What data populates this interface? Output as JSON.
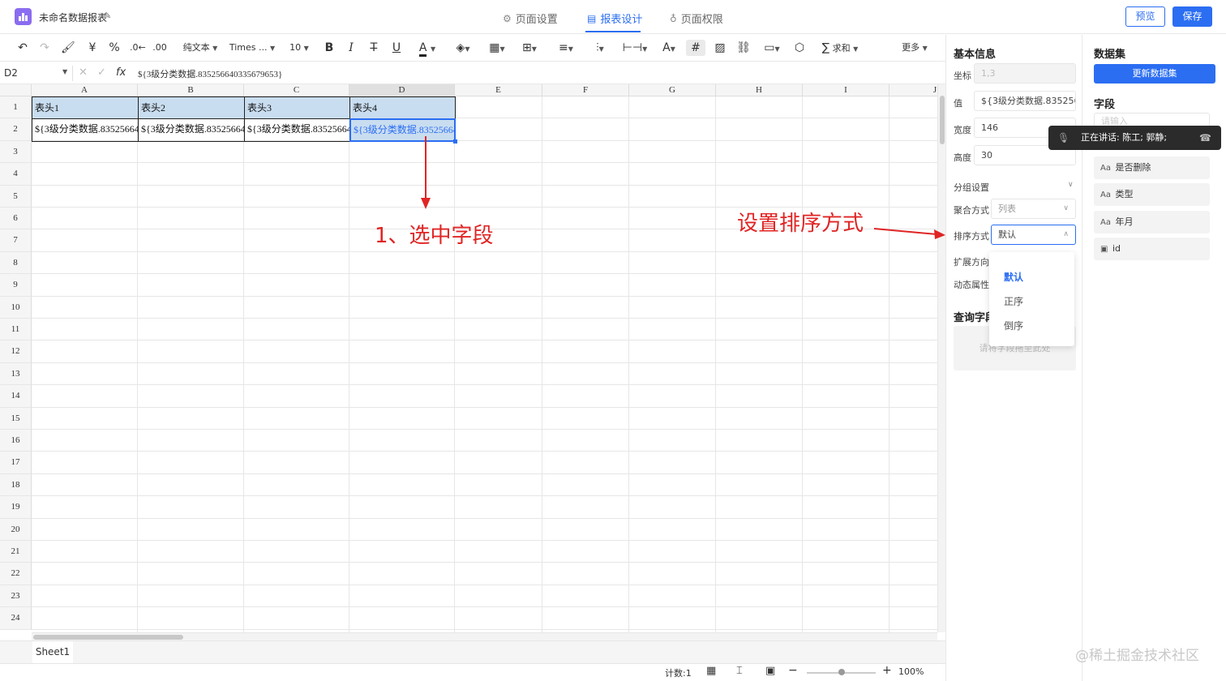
{
  "header": {
    "app_title": "未命名数据报表",
    "tabs": [
      {
        "label": "页面设置",
        "icon": "gear-icon"
      },
      {
        "label": "报表设计",
        "icon": "report-icon",
        "active": true
      },
      {
        "label": "页面权限",
        "icon": "permission-icon"
      }
    ],
    "preview_label": "预览",
    "save_label": "保存"
  },
  "toolbar": {
    "currency": "¥",
    "percent": "%",
    "format_label": "纯文本",
    "font_name": "Times ...",
    "font_size": "10",
    "bold": "B",
    "italic": "I",
    "underline": "U",
    "font_color": "A",
    "sum_label": "求和",
    "more_label": "更多"
  },
  "formula_bar": {
    "cell_ref": "D2",
    "fx": "fx",
    "value": "${3级分类数据.835256640335679653}"
  },
  "sheet": {
    "columns": [
      "A",
      "B",
      "C",
      "D",
      "E",
      "F",
      "G",
      "H",
      "I",
      "J"
    ],
    "selected_column": "D",
    "rows": [
      "1",
      "2",
      "3",
      "4",
      "5",
      "6",
      "7",
      "8",
      "9",
      "10",
      "11",
      "12",
      "13",
      "14",
      "15",
      "16",
      "17",
      "18",
      "19",
      "20",
      "21",
      "22",
      "23",
      "24"
    ],
    "header_cells": [
      "表头1",
      "表头2",
      "表头3",
      "表头4"
    ],
    "data_cells": [
      "${3级分类数据.835256640335679653}",
      "${3级分类数据.835256640335679653}",
      "${3级分类数据.835256640335679653}",
      "${3级分类数据.835256640335679653}"
    ],
    "sheet_tab": "Sheet1"
  },
  "status": {
    "count_label": "计数:1",
    "zoom": "100%"
  },
  "basic_info": {
    "title": "基本信息",
    "coord_label": "坐标",
    "coord_value": "1,3",
    "value_label": "值",
    "value_value": "${3级分类数据.835256640335679653}",
    "width_label": "宽度",
    "width_value": "146",
    "height_label": "高度",
    "height_value": "30",
    "group_settings_label": "分组设置",
    "aggregate_label": "聚合方式",
    "aggregate_value": "列表",
    "sort_label": "排序方式",
    "sort_value": "默认",
    "expand_label": "扩展方向",
    "dynamic_label": "动态属性",
    "query_label": "查询字段",
    "drop_placeholder": "请将字段拖至此处",
    "sort_options": [
      "默认",
      "正序",
      "倒序"
    ]
  },
  "dataset": {
    "title": "数据集",
    "refresh_label": "更新数据集",
    "fields_title": "字段",
    "search_placeholder": "请输入",
    "fields": [
      {
        "type": "Aa",
        "label": "是否删除"
      },
      {
        "type": "Aa",
        "label": "类型"
      },
      {
        "type": "Aa",
        "label": "年月"
      },
      {
        "type": "▣",
        "label": "id"
      }
    ]
  },
  "speaking": {
    "text": "正在讲话:  陈工; 郭静;"
  },
  "annotations": {
    "step1": "1、选中字段",
    "sort_note": "设置排序方式",
    "color": "#e02424"
  },
  "watermark": "@稀土掘金技术社区",
  "colors": {
    "accent": "#2b6ef2",
    "header_fill": "#c9ddf0",
    "logo": "#8a6cf0"
  }
}
